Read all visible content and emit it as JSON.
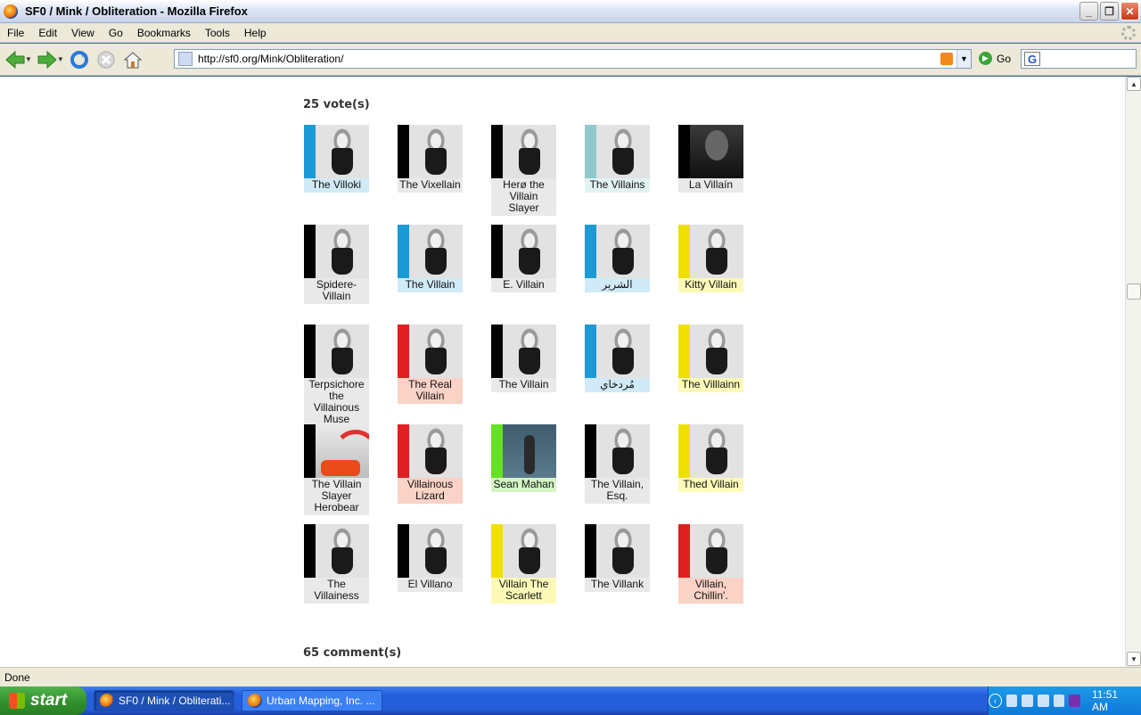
{
  "window": {
    "title": "SF0 / Mink / Obliteration - Mozilla Firefox",
    "minimize": "_",
    "restore": "❐",
    "close": "✕"
  },
  "menu": [
    "File",
    "Edit",
    "View",
    "Go",
    "Bookmarks",
    "Tools",
    "Help"
  ],
  "navigation": {
    "url": "http://sf0.org/Mink/Obliteration/",
    "go_label": "Go",
    "search_placeholder": ""
  },
  "page": {
    "votes_heading": "25 vote(s)",
    "comments_heading": "65 comment(s)",
    "votes": [
      {
        "name": "The Villoki",
        "color": "blue"
      },
      {
        "name": "The Vixellain",
        "color": "black"
      },
      {
        "name": "Herø the Villain Slayer",
        "color": "black"
      },
      {
        "name": "The Villains",
        "color": "teal"
      },
      {
        "name": "La Villaín",
        "color": "black"
      },
      {
        "name": "Spidere-Villain",
        "color": "black"
      },
      {
        "name": "The Villain",
        "color": "blue"
      },
      {
        "name": "E. Villain",
        "color": "black"
      },
      {
        "name": "الشرير",
        "color": "blue"
      },
      {
        "name": "Kitty Villain",
        "color": "yellow"
      },
      {
        "name": "Terpsichore the Villainous Muse",
        "color": "black"
      },
      {
        "name": "The Real Villain",
        "color": "red"
      },
      {
        "name": "The Villain",
        "color": "black"
      },
      {
        "name": "مُردخاي",
        "color": "blue"
      },
      {
        "name": "The Villlainn",
        "color": "yellow"
      },
      {
        "name": "The Villain Slayer Herobear",
        "color": "black"
      },
      {
        "name": "Villainous Lizard",
        "color": "red"
      },
      {
        "name": "Sean Mahan",
        "color": "green"
      },
      {
        "name": "The Villain, Esq.",
        "color": "black"
      },
      {
        "name": "Thed Villain",
        "color": "yellow"
      },
      {
        "name": "The Villainess",
        "color": "black"
      },
      {
        "name": "El Villano",
        "color": "black"
      },
      {
        "name": "Villain The Scarlett",
        "color": "yellow"
      },
      {
        "name": "The Villank",
        "color": "black"
      },
      {
        "name": "Villain, Chillin'.",
        "color": "red"
      }
    ]
  },
  "status": {
    "text": "Done"
  },
  "taskbar": {
    "start_label": "start",
    "tasks": [
      "SF0 / Mink / Obliterati...",
      "Urban Mapping, Inc. ..."
    ],
    "clock": "11:51 AM"
  },
  "colors": {
    "blue": "#1c9ad6",
    "black": "#000000",
    "teal": "#8fc9c9",
    "yellow": "#f0e000",
    "red": "#e02020",
    "green": "#66e022"
  }
}
